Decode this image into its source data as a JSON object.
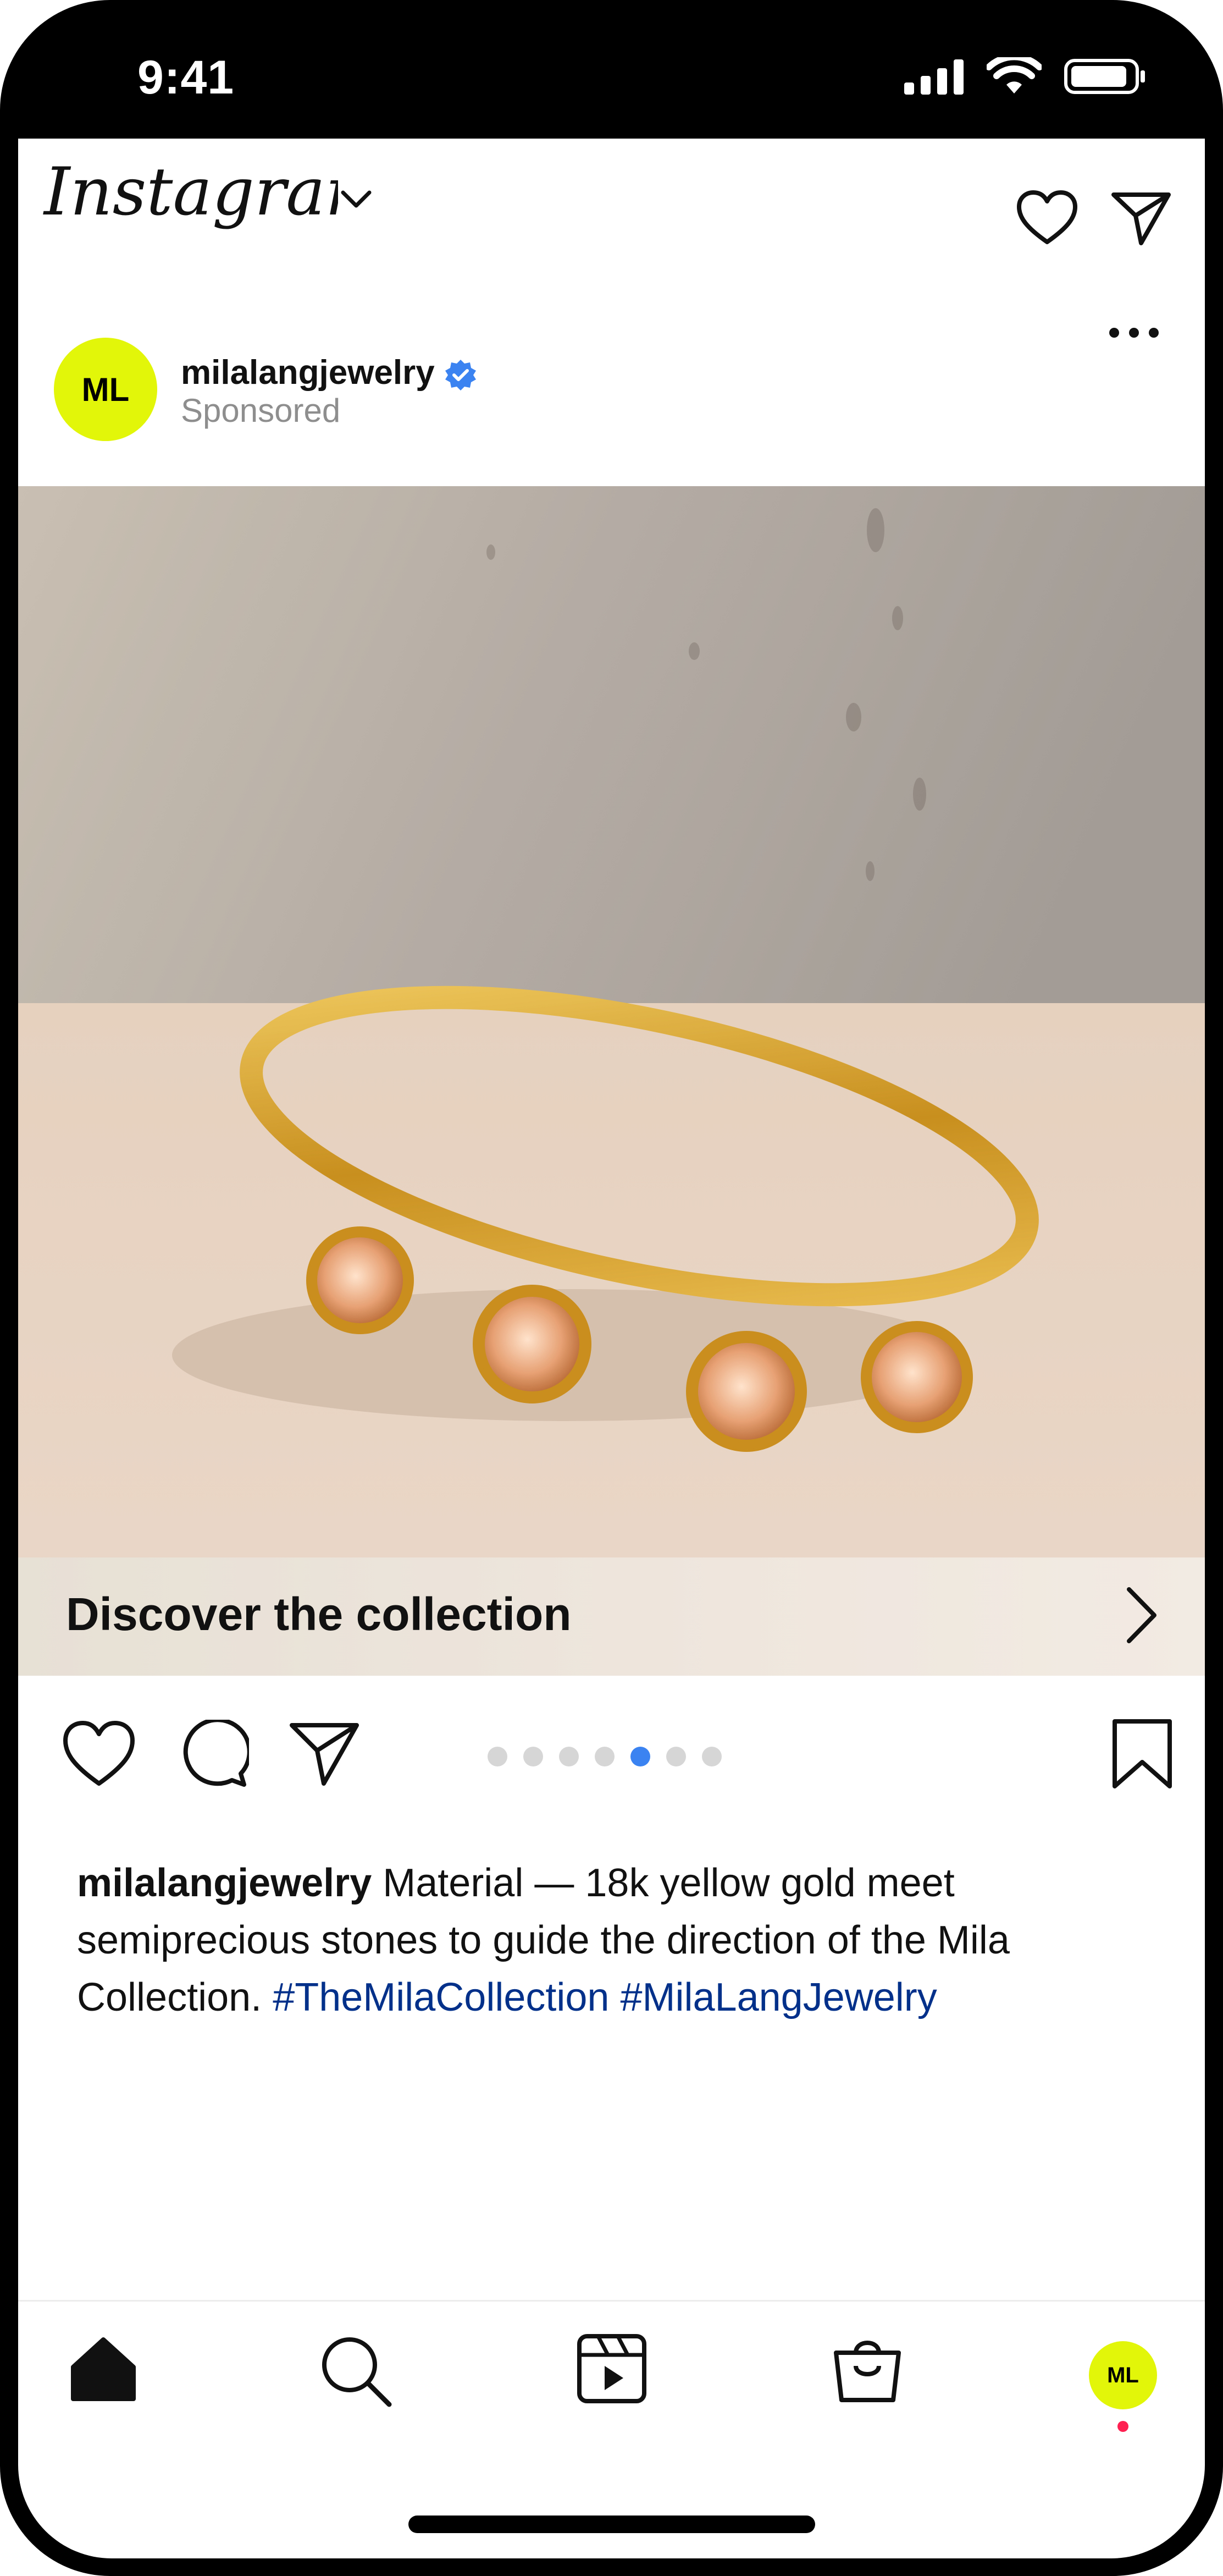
{
  "status_bar": {
    "time": "9:41"
  },
  "app": {
    "logo_text": "Instagram"
  },
  "post": {
    "avatar_initials": "ML",
    "username": "milalangjewelry",
    "sponsored_label": "Sponsored",
    "media_description": "Gold bangle with four peach round-cut stones",
    "cta_label": "Discover the collection",
    "carousel": {
      "count": 7,
      "active_index": 4
    },
    "caption": {
      "username": "milalangjewelry",
      "text": "Material — 18k yellow gold meet semiprecious stones to guide the direction of the Mila Collection.",
      "hashtags": [
        "#TheMilaCollection",
        "#MilaLangJewelry"
      ]
    }
  },
  "bottom_nav": {
    "items": [
      "home-icon",
      "search-icon",
      "reels-icon",
      "shop-icon",
      "profile-avatar"
    ],
    "profile_initials": "ML"
  },
  "colors": {
    "brand_accent": "#E2F609",
    "verified_blue": "#3B83F0",
    "hashtag": "#00308A",
    "notification": "#FF2052"
  }
}
